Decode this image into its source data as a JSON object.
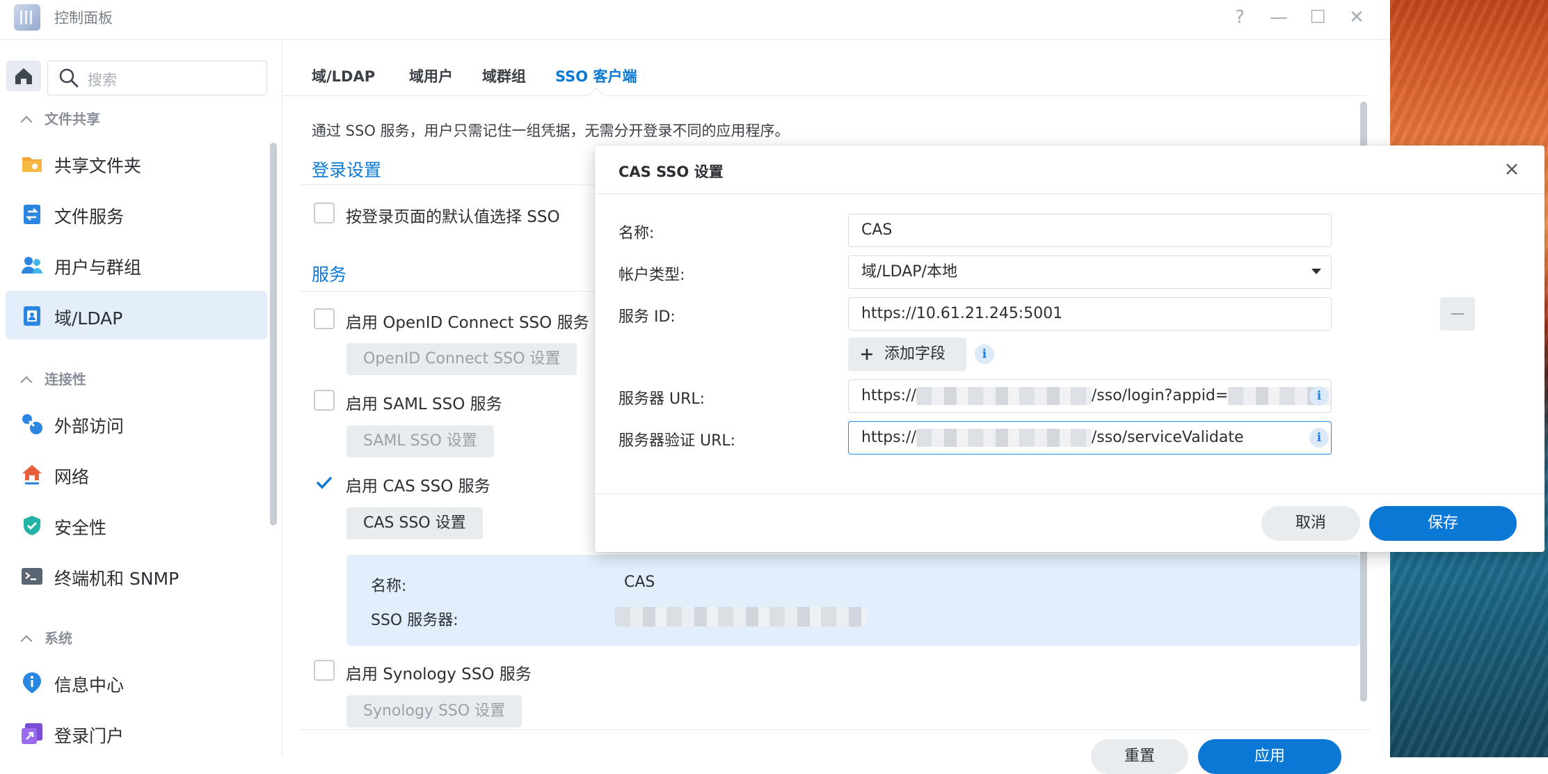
{
  "window": {
    "title": "控制面板",
    "help": "?",
    "minimize": "—",
    "maximize": "☐",
    "close": "✕"
  },
  "sidebar": {
    "search_placeholder": "搜索",
    "sections": [
      {
        "title": "文件共享",
        "items": [
          "共享文件夹",
          "文件服务",
          "用户与群组",
          "域/LDAP"
        ]
      },
      {
        "title": "连接性",
        "items": [
          "外部访问",
          "网络",
          "安全性",
          "终端机和 SNMP"
        ]
      },
      {
        "title": "系统",
        "items": [
          "信息中心",
          "登录门户"
        ]
      }
    ],
    "active_item": "域/LDAP"
  },
  "tabs": [
    "域/LDAP",
    "域用户",
    "域群组",
    "SSO 客户端"
  ],
  "active_tab": "SSO 客户端",
  "main": {
    "description": "通过 SSO 服务，用户只需记住一组凭据，无需分开登录不同的应用程序。",
    "login_settings_title": "登录设置",
    "default_sso_label": "按登录页面的默认值选择 SSO",
    "default_sso_checked": false,
    "services_title": "服务",
    "openid": {
      "label": "启用 OpenID Connect SSO 服务",
      "checked": false,
      "button": "OpenID Connect SSO 设置"
    },
    "saml": {
      "label": "启用 SAML SSO 服务",
      "checked": false,
      "button": "SAML SSO 设置"
    },
    "cas": {
      "label": "启用 CAS SSO 服务",
      "checked": true,
      "button": "CAS SSO 设置",
      "info": {
        "name_label": "名称:",
        "name_value": "CAS",
        "server_label": "SSO 服务器:"
      }
    },
    "synology": {
      "label": "启用 Synology SSO 服务",
      "checked": false,
      "button": "Synology SSO 设置"
    },
    "reset_button": "重置",
    "apply_button": "应用"
  },
  "modal": {
    "title": "CAS SSO 设置",
    "fields": {
      "name_label": "名称:",
      "name_value": "CAS",
      "account_type_label": "帐户类型:",
      "account_type_value": "域/LDAP/本地",
      "service_id_label": "服务 ID:",
      "service_id_value": "https://10.61.21.245:5001",
      "add_field_button": "添加字段",
      "server_url_label": "服务器 URL:",
      "server_url_prefix": "https://",
      "server_url_suffix": "/sso/login?appid=",
      "validate_url_label": "服务器验证 URL:",
      "validate_url_prefix": "https://",
      "validate_url_suffix": "/sso/serviceValidate"
    },
    "cancel_button": "取消",
    "save_button": "保存"
  },
  "colors": {
    "accent": "#0a78d4",
    "active_bg": "#e3eefa",
    "info_panel": "#e2eefb"
  }
}
